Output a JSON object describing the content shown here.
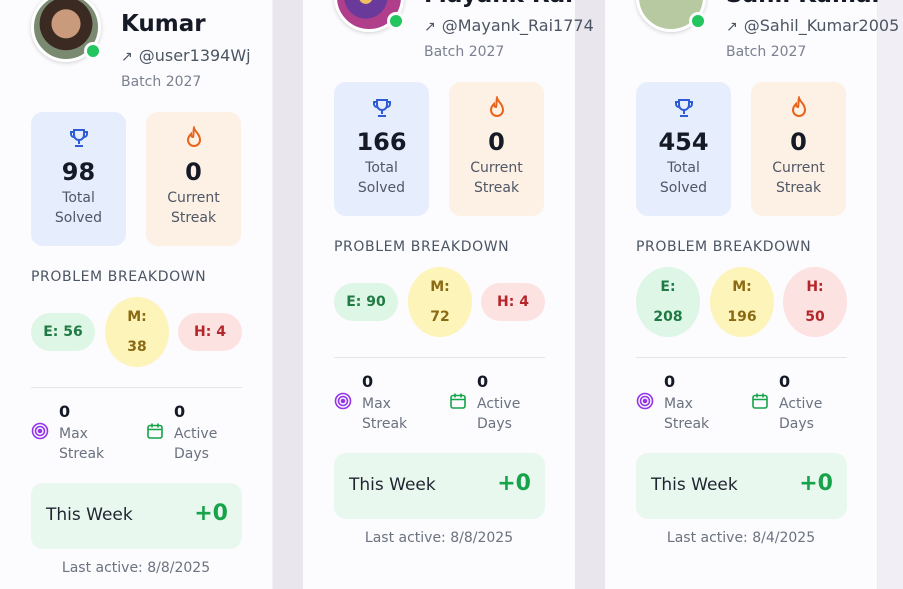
{
  "cards": [
    {
      "name": "Kumar",
      "handle": "@user1394Wj",
      "batch": "Batch 2027",
      "total_solved": "98",
      "total_solved_label_1": "Total",
      "total_solved_label_2": "Solved",
      "current_streak": "0",
      "current_streak_label_1": "Current",
      "current_streak_label_2": "Streak",
      "breakdown_title": "PROBLEM BREAKDOWN",
      "easy": "E: 56",
      "medium_1": "M:",
      "medium_2": "38",
      "hard": "H: 4",
      "max_streak": "0",
      "max_streak_label_1": "Max",
      "max_streak_label_2": "Streak",
      "active_days": "0",
      "active_days_label_1": "Active",
      "active_days_label_2": "Days",
      "this_week_label": "This Week",
      "this_week_value": "+0",
      "last_active": "Last active: 8/8/2025"
    },
    {
      "name": "Mayank Rai",
      "handle": "@Mayank_Rai1774",
      "batch": "Batch 2027",
      "total_solved": "166",
      "total_solved_label_1": "Total",
      "total_solved_label_2": "Solved",
      "current_streak": "0",
      "current_streak_label_1": "Current",
      "current_streak_label_2": "Streak",
      "breakdown_title": "PROBLEM BREAKDOWN",
      "easy": "E: 90",
      "medium_1": "M:",
      "medium_2": "72",
      "hard": "H: 4",
      "max_streak": "0",
      "max_streak_label_1": "Max",
      "max_streak_label_2": "Streak",
      "active_days": "0",
      "active_days_label_1": "Active",
      "active_days_label_2": "Days",
      "this_week_label": "This Week",
      "this_week_value": "+0",
      "last_active": "Last active: 8/8/2025"
    },
    {
      "name": "Sahil Kumar",
      "handle": "@Sahil_Kumar2005",
      "batch": "Batch 2027",
      "total_solved": "454",
      "total_solved_label_1": "Total",
      "total_solved_label_2": "Solved",
      "current_streak": "0",
      "current_streak_label_1": "Current",
      "current_streak_label_2": "Streak",
      "breakdown_title": "PROBLEM BREAKDOWN",
      "easy_1": "E:",
      "easy_2": "208",
      "medium_1": "M:",
      "medium_2": "196",
      "hard_1": "H:",
      "hard_2": "50",
      "max_streak": "0",
      "max_streak_label_1": "Max",
      "max_streak_label_2": "Streak",
      "active_days": "0",
      "active_days_label_1": "Active",
      "active_days_label_2": "Days",
      "this_week_label": "This Week",
      "this_week_value": "+0",
      "last_active": "Last active: 8/4/2025"
    }
  ],
  "icons": {
    "trophy": "trophy-icon",
    "flame": "flame-icon",
    "target": "target-icon",
    "calendar": "calendar-icon",
    "external_link": "external-link-icon"
  },
  "colors": {
    "online": "#22c55e",
    "easy_bg": "#ddf6e6",
    "medium_bg": "#fdf4b9",
    "hard_bg": "#fde2e2",
    "week_value": "#16a34a",
    "trophy": "#2f5bd6",
    "flame": "#e8641b",
    "target": "#9333ea",
    "calendar": "#16a34a"
  }
}
